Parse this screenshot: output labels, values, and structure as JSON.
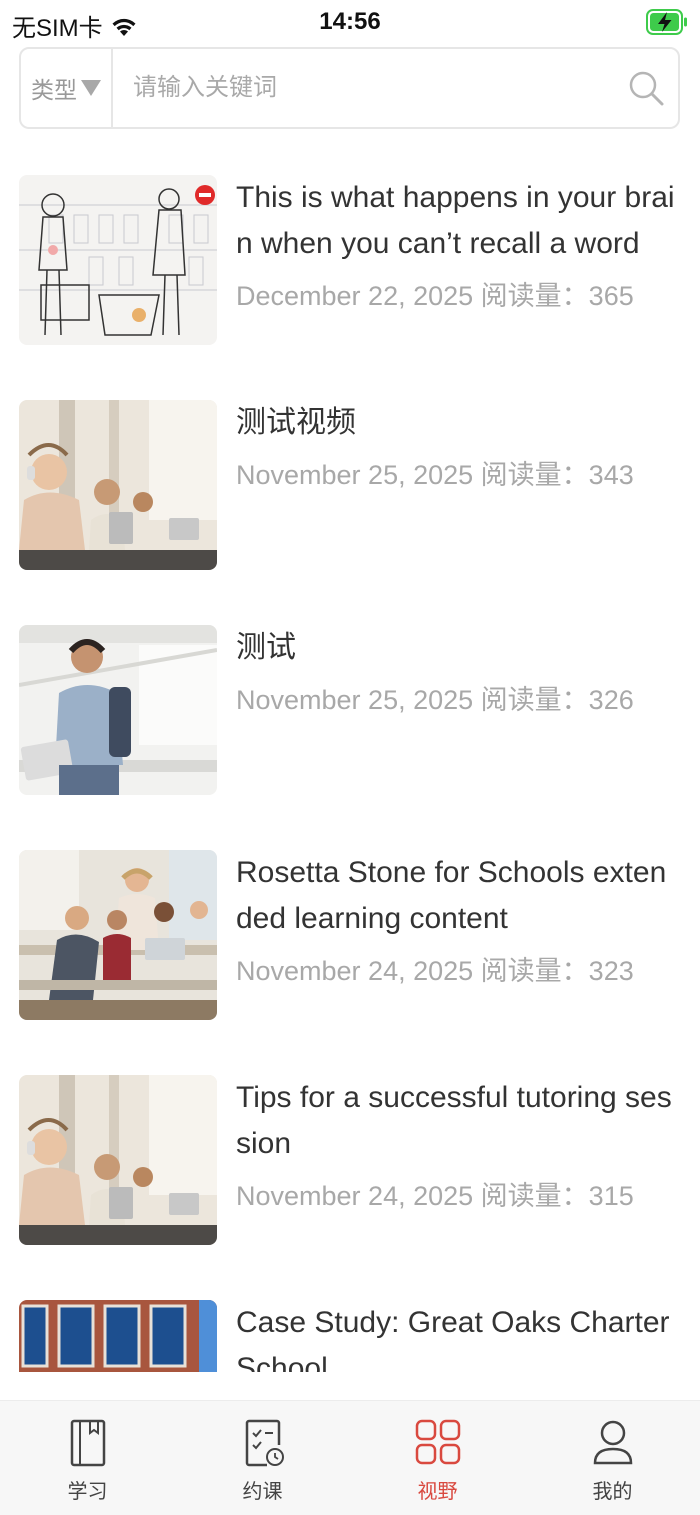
{
  "status_bar": {
    "carrier": "无SIM卡",
    "time": "14:56"
  },
  "search": {
    "type_label": "类型",
    "placeholder": "请输入关键词",
    "value": ""
  },
  "read_label": "阅读量：",
  "articles": [
    {
      "title": "This is what happens in your brain when you can’t recall a word",
      "date": "December 22, 2025",
      "reads": "365",
      "thumb": "ted-sketch"
    },
    {
      "title": "测试视频",
      "date": "November 25, 2025",
      "reads": "343",
      "thumb": "kids-headphones"
    },
    {
      "title": "测试",
      "date": "November 25, 2025",
      "reads": "326",
      "thumb": "student-tablet"
    },
    {
      "title": "Rosetta Stone for Schools extended learning content",
      "date": "November 24, 2025",
      "reads": "323",
      "thumb": "classroom"
    },
    {
      "title": "Tips for a successful tutoring session",
      "date": "November 24, 2025",
      "reads": "315",
      "thumb": "kids-headphones"
    },
    {
      "title": "Case Study: Great Oaks Charter School",
      "date": "",
      "reads": "",
      "thumb": "brick-building"
    }
  ],
  "tabs": [
    {
      "label": "学习",
      "icon": "book-icon",
      "active": false
    },
    {
      "label": "约课",
      "icon": "schedule-icon",
      "active": false
    },
    {
      "label": "视野",
      "icon": "grid-icon",
      "active": true
    },
    {
      "label": "我的",
      "icon": "user-icon",
      "active": false
    }
  ],
  "colors": {
    "accent": "#d9493f",
    "meta_gray": "#a8a8a8",
    "battery_green": "#3ecb4b"
  }
}
